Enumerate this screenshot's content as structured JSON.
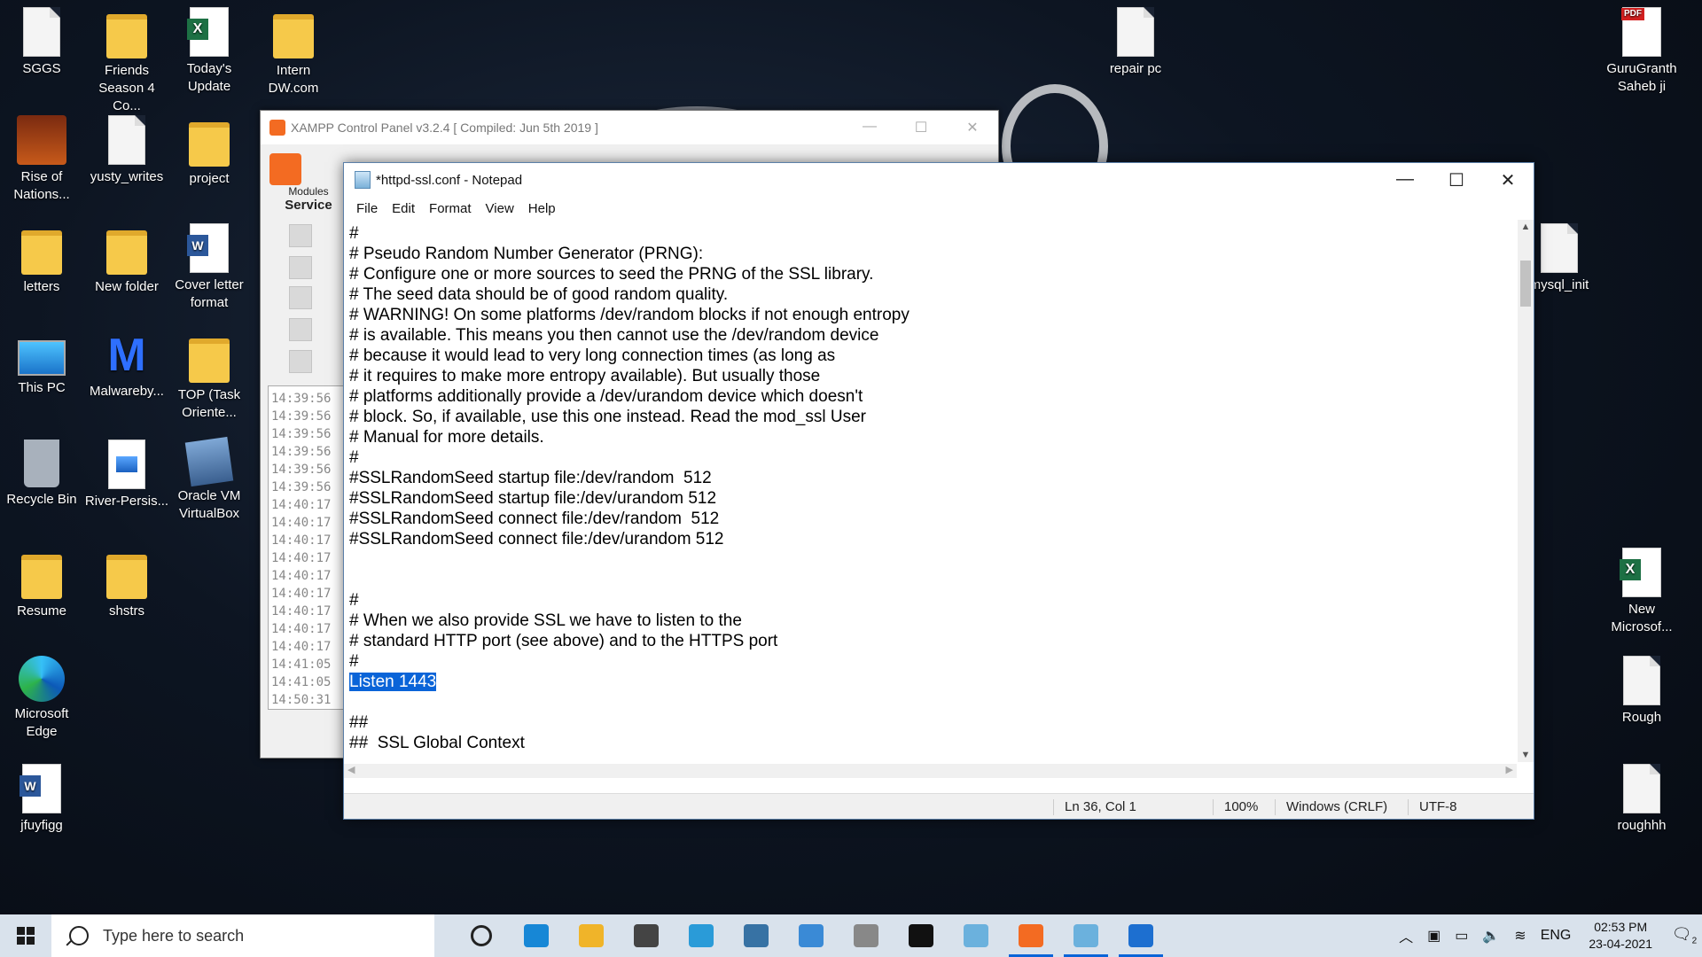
{
  "desktop": {
    "icons": [
      {
        "label": "SGGS",
        "type": "doc"
      },
      {
        "label": "Friends Season 4 Co...",
        "type": "folder"
      },
      {
        "label": "Today's Update",
        "type": "excel"
      },
      {
        "label": "Intern DW.com",
        "type": "folder"
      },
      {
        "label": "repair pc",
        "type": "doc"
      },
      {
        "label": "GuruGranth Saheb ji",
        "type": "pdf"
      },
      {
        "label": "Rise of Nations...",
        "type": "game"
      },
      {
        "label": "yusty_writes",
        "type": "doc"
      },
      {
        "label": "project",
        "type": "folder"
      },
      {
        "label": "letters",
        "type": "folder"
      },
      {
        "label": "New folder",
        "type": "folder"
      },
      {
        "label": "Cover letter format",
        "type": "word"
      },
      {
        "label": "This PC",
        "type": "pc"
      },
      {
        "label": "Malwareby...",
        "type": "malware"
      },
      {
        "label": "TOP (Task Oriente...",
        "type": "folder"
      },
      {
        "label": "Recycle Bin",
        "type": "recycle"
      },
      {
        "label": "River-Persis...",
        "type": "image"
      },
      {
        "label": "Oracle VM VirtualBox",
        "type": "vbox"
      },
      {
        "label": "Resume",
        "type": "folder"
      },
      {
        "label": "shstrs",
        "type": "folder"
      },
      {
        "label": "Microsoft Edge",
        "type": "edge"
      },
      {
        "label": "jfuyfigg",
        "type": "word"
      },
      {
        "label": "mysql_init",
        "type": "doc"
      },
      {
        "label": "New Microsof...",
        "type": "excel"
      },
      {
        "label": "Rough",
        "type": "doc"
      },
      {
        "label": "roughhh",
        "type": "doc"
      }
    ]
  },
  "xampp": {
    "title": "XAMPP Control Panel v3.2.4   [ Compiled: Jun 5th 2019 ]",
    "modules_label": "Modules",
    "service_label": "Service",
    "log_times": [
      "14:39:56",
      "14:39:56",
      "14:39:56",
      "14:39:56",
      "14:39:56",
      "14:39:56",
      "14:40:17",
      "14:40:17",
      "14:40:17",
      "14:40:17",
      "14:40:17",
      "14:40:17",
      "14:40:17",
      "14:40:17",
      "14:40:17",
      "14:41:05",
      "14:41:05",
      "14:50:31"
    ]
  },
  "notepad": {
    "title": "*httpd-ssl.conf - Notepad",
    "menu": [
      "File",
      "Edit",
      "Format",
      "View",
      "Help"
    ],
    "lines": [
      "#",
      "# Pseudo Random Number Generator (PRNG):",
      "# Configure one or more sources to seed the PRNG of the SSL library.",
      "# The seed data should be of good random quality.",
      "# WARNING! On some platforms /dev/random blocks if not enough entropy",
      "# is available. This means you then cannot use the /dev/random device",
      "# because it would lead to very long connection times (as long as",
      "# it requires to make more entropy available). But usually those",
      "# platforms additionally provide a /dev/urandom device which doesn't",
      "# block. So, if available, use this one instead. Read the mod_ssl User",
      "# Manual for more details.",
      "#",
      "#SSLRandomSeed startup file:/dev/random  512",
      "#SSLRandomSeed startup file:/dev/urandom 512",
      "#SSLRandomSeed connect file:/dev/random  512",
      "#SSLRandomSeed connect file:/dev/urandom 512",
      "",
      "",
      "#",
      "# When we also provide SSL we have to listen to the",
      "# standard HTTP port (see above) and to the HTTPS port",
      "#",
      "Listen 1443",
      "",
      "##",
      "##  SSL Global Context"
    ],
    "selected_line_index": 22,
    "status": {
      "position": "Ln 36, Col 1",
      "zoom": "100%",
      "line_ending": "Windows (CRLF)",
      "encoding": "UTF-8"
    }
  },
  "taskbar": {
    "search_placeholder": "Type here to search",
    "pinned": [
      "task-view",
      "edge",
      "file-explorer",
      "settings",
      "snipping",
      "python",
      "remote",
      "photos-app",
      "terminal",
      "notepad-app",
      "xampp",
      "notepad2",
      "photos"
    ],
    "language": "ENG",
    "time": "02:53 PM",
    "date": "23-04-2021",
    "notification_count": "2"
  }
}
